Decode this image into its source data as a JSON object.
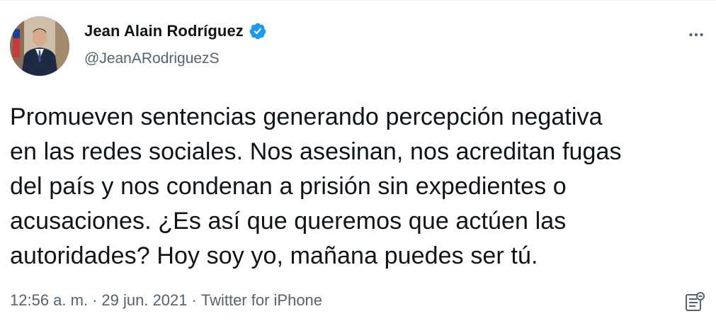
{
  "author": {
    "display_name": "Jean Alain Rodríguez",
    "handle": "@JeanARodriguezS",
    "verified_icon": "verified-badge-icon",
    "avatar_icon": "profile-photo"
  },
  "tweet": {
    "text": "Promueven sentencias generando percepción negativa\nen las redes sociales. Nos asesinan, nos acreditan fugas\ndel país y nos condenan a prisión sin expedientes o\nacusaciones. ¿Es así que queremos que actúen las\nautoridades? Hoy soy yo, mañana puedes ser tú."
  },
  "meta": {
    "time": "12:56 a. m.",
    "separator": "·",
    "date": "29 jun. 2021",
    "source": "Twitter for iPhone"
  },
  "icons": {
    "more": "more-options-icon",
    "analytics": "analytics-icon"
  },
  "colors": {
    "text_primary": "#0f1419",
    "text_secondary": "#536471",
    "verified_blue": "#1d9bf0"
  }
}
